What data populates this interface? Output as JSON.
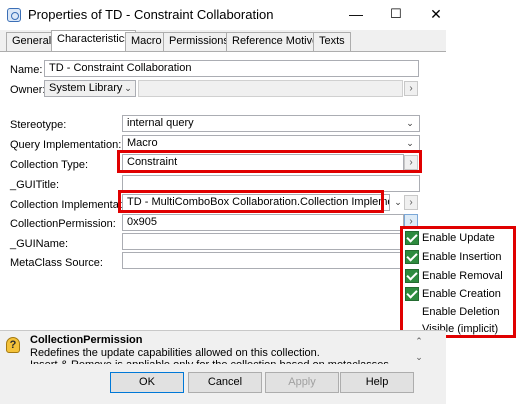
{
  "window": {
    "title": "Properties of TD - Constraint Collaboration",
    "minimize": "—",
    "maximize": "☐",
    "close": "✕"
  },
  "tabs": [
    {
      "label": "General"
    },
    {
      "label": "Characteristics"
    },
    {
      "label": "Macro"
    },
    {
      "label": "Permissions"
    },
    {
      "label": "Reference Motive"
    },
    {
      "label": "Texts"
    }
  ],
  "form": {
    "name_label": "Name:",
    "name_value": "TD - Constraint Collaboration",
    "owner_label": "Owner:",
    "owner_value": "System Library",
    "stereotype_label": "Stereotype:",
    "stereotype_value": "internal query",
    "query_impl_label": "Query Implementation:",
    "query_impl_value": "Macro",
    "collection_type_label": "Collection Type:",
    "collection_type_value": "Constraint",
    "guititle_label": "_GUITitle:",
    "guititle_value": "",
    "collection_impl_label": "Collection Implementation:",
    "collection_impl_value": "TD - MultiComboBox Collaboration.Collection Implementation",
    "collection_perm_label": "CollectionPermission:",
    "collection_perm_value": "0x905",
    "guiname_label": "_GUIName:",
    "guiname_value": "",
    "metaclass_label": "MetaClass Source:",
    "metaclass_value": ""
  },
  "menu": {
    "items": [
      {
        "label": "Enable Update",
        "checked": true
      },
      {
        "label": "Enable Insertion",
        "checked": true
      },
      {
        "label": "Enable Removal",
        "checked": true
      },
      {
        "label": "Enable Creation",
        "checked": true
      },
      {
        "label": "Enable Deletion",
        "checked": false
      },
      {
        "label": "Visible (implicit)",
        "checked": false
      }
    ]
  },
  "help": {
    "title": "CollectionPermission",
    "line1": "Redefines the update capabilities allowed on this collection.",
    "line2": "Insert & Remove is appliable only for the collection based on metaclasses"
  },
  "buttons": {
    "ok": "OK",
    "cancel": "Cancel",
    "apply": "Apply",
    "help": "Help"
  },
  "colors": {
    "highlight_red": "#e00000",
    "check_green": "#2e8b3f"
  }
}
